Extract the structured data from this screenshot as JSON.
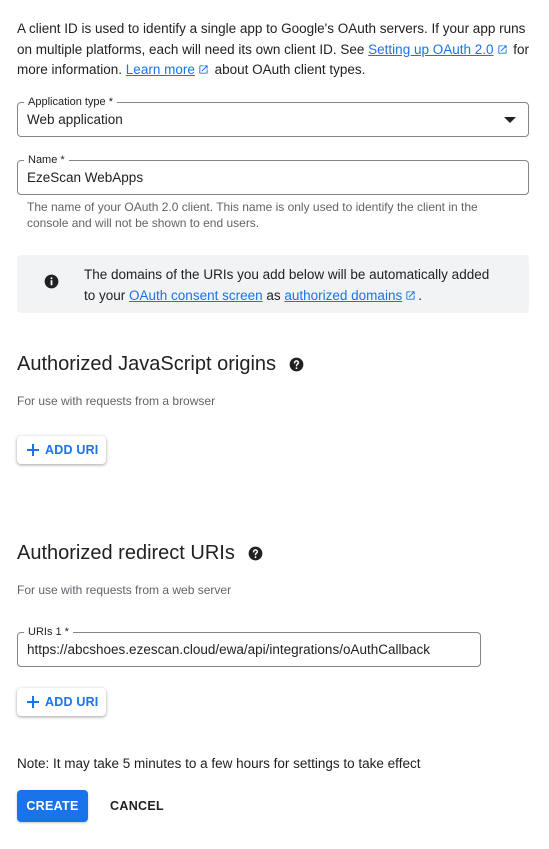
{
  "intro": {
    "text_before": "A client ID is used to identify a single app to Google's OAuth servers. If your app runs on multiple platforms, each will need its own client ID. See ",
    "link_setup": "Setting up OAuth 2.0",
    "text_middle": " for more information. ",
    "link_learn": "Learn more",
    "text_after": " about OAuth client types."
  },
  "application_type": {
    "label": "Application type *",
    "value": "Web application"
  },
  "name_field": {
    "label": "Name *",
    "value": "EzeScan WebApps",
    "hint": "The name of your OAuth 2.0 client. This name is only used to identify the client in the console and will not be shown to end users."
  },
  "info": {
    "text_before": "The domains of the URIs you add below will be automatically added to your ",
    "link_consent": "OAuth consent screen",
    "text_middle": " as ",
    "link_domains": "authorized domains",
    "text_after": "."
  },
  "js_origins": {
    "title": "Authorized JavaScript origins",
    "subtitle": "For use with requests from a browser",
    "add_label": "ADD URI"
  },
  "redirect_uris": {
    "title": "Authorized redirect URIs",
    "subtitle": "For use with requests from a web server",
    "uri_label": "URIs 1 *",
    "uri_value": "https://abcshoes.ezescan.cloud/ewa/api/integrations/oAuthCallback",
    "add_label": "ADD URI"
  },
  "note": "Note: It may take 5 minutes to a few hours for settings to take effect",
  "actions": {
    "create": "CREATE",
    "cancel": "CANCEL"
  },
  "colors": {
    "primary": "#1a73e8",
    "text": "#202124",
    "secondary_text": "#5f6368",
    "info_bg": "#f1f3f4"
  }
}
